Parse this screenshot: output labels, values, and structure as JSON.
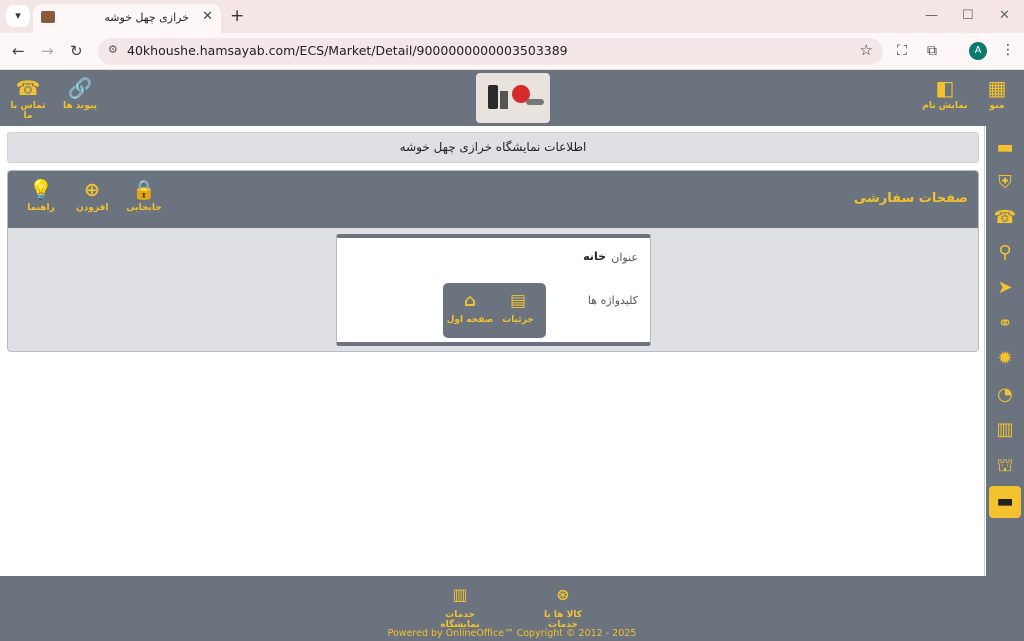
{
  "browser": {
    "tab_title": "خرازی چهل خوشه",
    "url": "40khoushe.hamsayab.com/ECS/Market/Detail/9000000000003503389",
    "avatar_letter": "A"
  },
  "header": {
    "menu_label": "منو",
    "show_name_label": "نمایش نام",
    "links_label": "پیوند ها",
    "contact_label": "تماس با ما"
  },
  "main": {
    "info_title": "اطلاعات نمایشگاه خرازی چهل خوشه",
    "panel_title": "صفحات سفارشی",
    "move_label": "جابجایی",
    "add_label": "افزودن",
    "help_label": "راهنما",
    "card": {
      "title_label": "عنوان",
      "title_value": "خانه",
      "keywords_label": "کلیدواژه ها",
      "details_label": "جزئیات",
      "home_label": "صفحه اول"
    }
  },
  "footer": {
    "products_label": "کالا ها یا خدمات",
    "services_label": "خدمات نمایشگاه",
    "copyright": "Powered by OnlineOffice™ Copyright © 2012 - 2025"
  },
  "colors": {
    "accent": "#f3c22e",
    "bar": "#6b737e"
  }
}
